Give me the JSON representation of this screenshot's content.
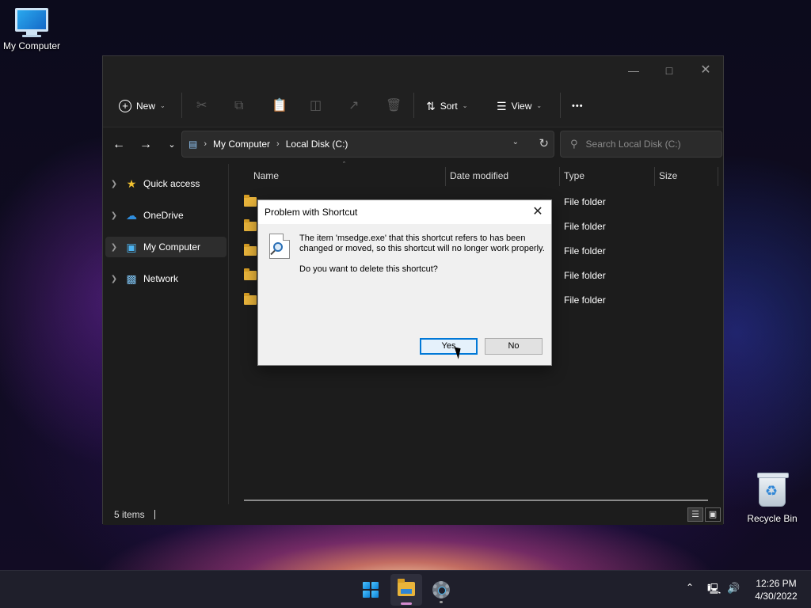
{
  "desktop": {
    "icons": [
      {
        "label": "My Computer"
      },
      {
        "label": "Recycle Bin"
      }
    ]
  },
  "explorer": {
    "toolbar": {
      "new_label": "New",
      "sort_label": "Sort",
      "view_label": "View",
      "more_label": "•••"
    },
    "address": {
      "crumbs": [
        "My Computer",
        "Local Disk (C:)"
      ]
    },
    "search": {
      "placeholder": "Search Local Disk (C:)"
    },
    "sidebar": {
      "items": [
        {
          "label": "Quick access",
          "icon": "star-icon"
        },
        {
          "label": "OneDrive",
          "icon": "cloud-icon"
        },
        {
          "label": "My Computer",
          "icon": "computer-icon",
          "selected": true
        },
        {
          "label": "Network",
          "icon": "network-icon"
        }
      ]
    },
    "columns": {
      "name": "Name",
      "date_modified": "Date modified",
      "type": "Type",
      "size": "Size"
    },
    "rows": [
      {
        "type": "File folder"
      },
      {
        "type": "File folder"
      },
      {
        "type": "File folder"
      },
      {
        "type": "File folder"
      },
      {
        "type": "File folder"
      }
    ],
    "status": {
      "item_count": "5 items"
    }
  },
  "dialog": {
    "title": "Problem with Shortcut",
    "message": "The item 'msedge.exe' that this shortcut refers to has been changed or moved, so this shortcut will no longer work properly.",
    "question": "Do you want to delete this shortcut?",
    "yes_label": "Yes",
    "no_label": "No"
  },
  "taskbar": {
    "time": "12:26 PM",
    "date": "4/30/2022"
  },
  "colors": {
    "accent": "#0078d7",
    "folder": "#e9b43b",
    "window_bg": "#1c1c1c"
  }
}
